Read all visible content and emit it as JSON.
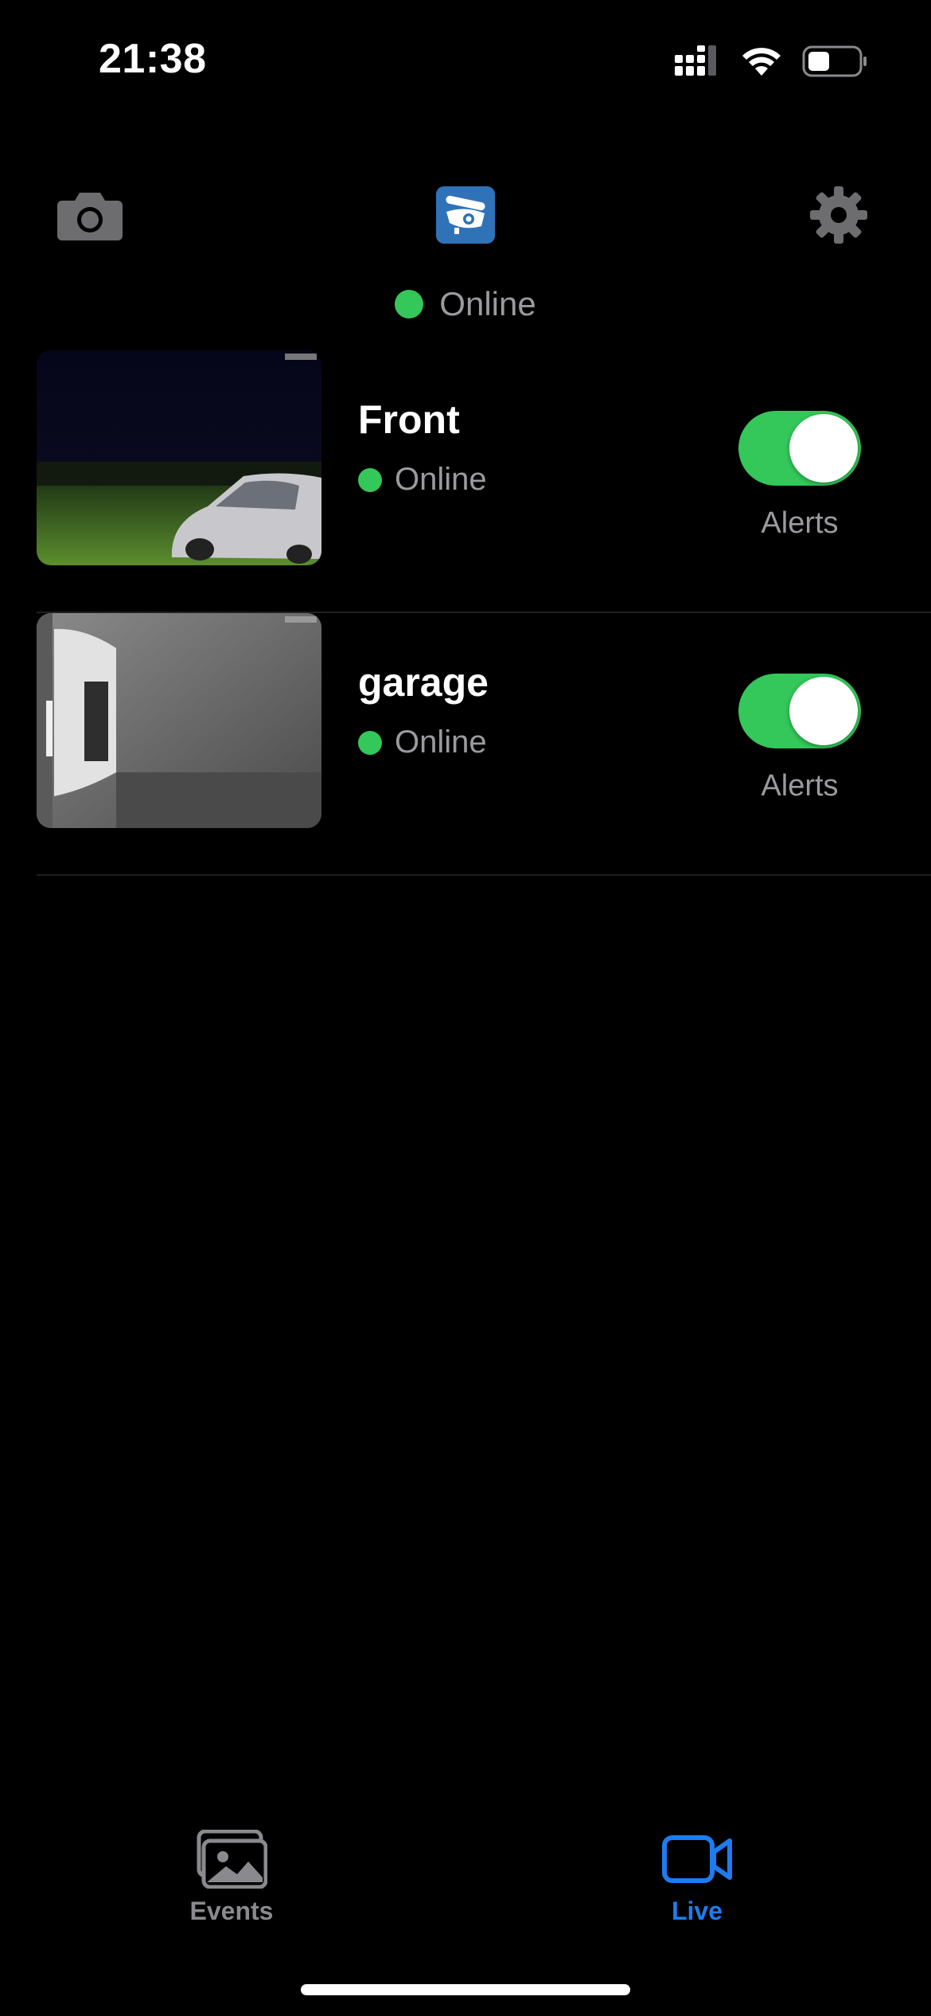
{
  "status_bar": {
    "time": "21:38",
    "icons": [
      "cellular-signal-icon",
      "wifi-icon",
      "battery-icon"
    ]
  },
  "header": {
    "left_icon": "camera-icon",
    "logo_icon": "security-camera-logo-icon",
    "right_icon": "gear-icon",
    "hub_status": "Online",
    "status_color": "#34c759"
  },
  "cameras": [
    {
      "name": "Front",
      "status": "Online",
      "alerts_label": "Alerts",
      "alerts_on": true,
      "thumbnail": "night-front-yard-with-car"
    },
    {
      "name": "garage",
      "status": "Online",
      "alerts_label": "Alerts",
      "alerts_on": true,
      "thumbnail": "infrared-garage-view"
    }
  ],
  "tab_bar": {
    "tabs": [
      {
        "label": "Events",
        "icon": "photos-icon",
        "active": false
      },
      {
        "label": "Live",
        "icon": "video-camera-icon",
        "active": true
      }
    ],
    "active_color": "#1e7cf0",
    "inactive_color": "#8a8a8e"
  }
}
